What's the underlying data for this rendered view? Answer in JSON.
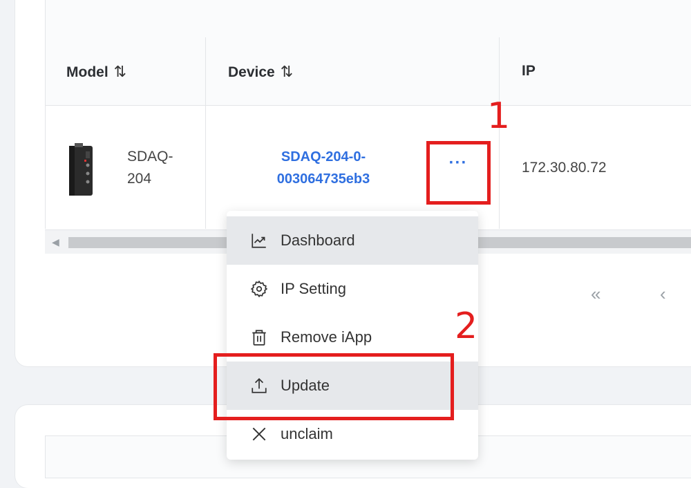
{
  "table": {
    "columns": [
      {
        "label": "Model",
        "sortable": true,
        "sort_icon": "⇅"
      },
      {
        "label": "Device",
        "sortable": true,
        "sort_icon": "⇅"
      },
      {
        "label": "IP",
        "sortable": false
      }
    ],
    "rows": [
      {
        "model_line1": "SDAQ-",
        "model_line2": "204",
        "device_line1": "SDAQ-204-0-",
        "device_line2": "003064735eb3",
        "more_label": "···",
        "ip": "172.30.80.72"
      }
    ]
  },
  "pagination": {
    "first_label": "«",
    "prev_label": "‹"
  },
  "context_menu": {
    "items": [
      {
        "label": "Dashboard",
        "icon": "chart-icon",
        "highlighted": true
      },
      {
        "label": "IP Setting",
        "icon": "gear-icon",
        "highlighted": false
      },
      {
        "label": "Remove iApp",
        "icon": "trash-icon",
        "highlighted": false
      },
      {
        "label": "Update",
        "icon": "upload-icon",
        "highlighted": true
      },
      {
        "label": "unclaim",
        "icon": "close-icon",
        "highlighted": false
      }
    ]
  },
  "annotations": {
    "step1": "1",
    "step2": "2",
    "color": "#e41e1e"
  },
  "colors": {
    "link": "#2f6fe0",
    "menu_highlight": "#e6e8eb"
  }
}
